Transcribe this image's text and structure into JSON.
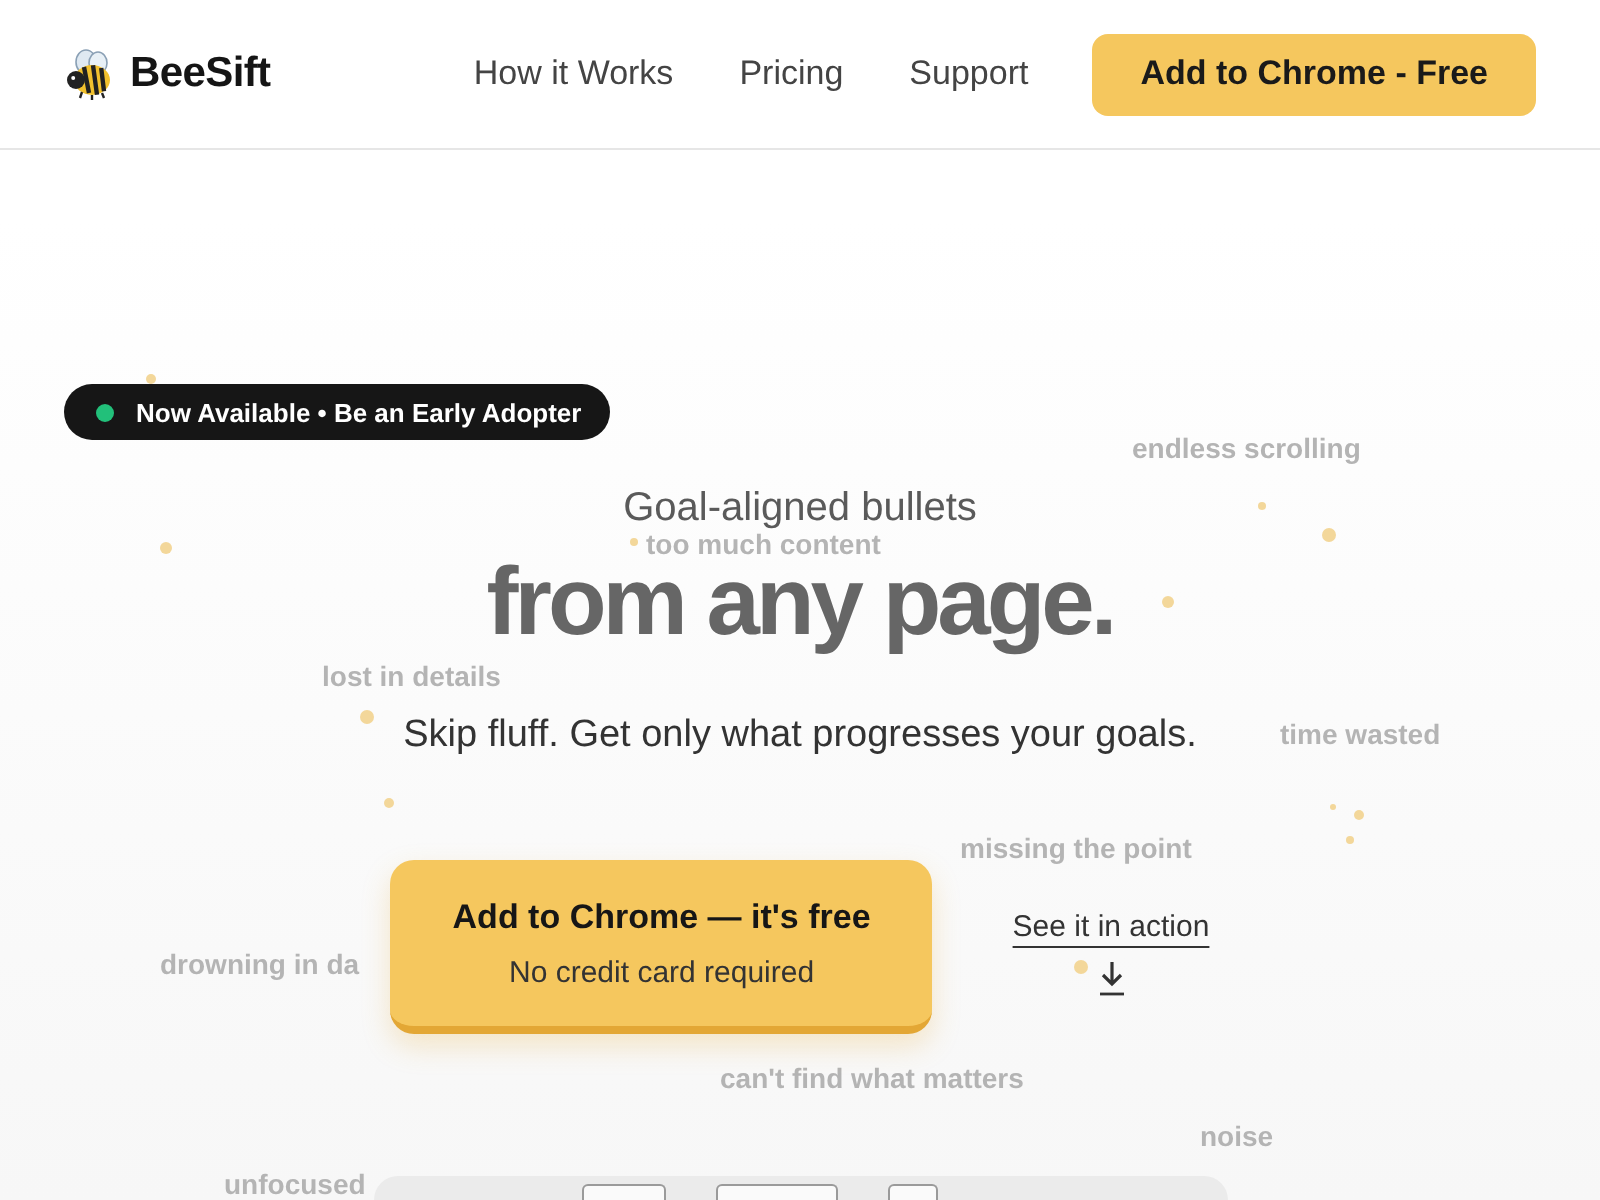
{
  "header": {
    "logo": "BeeSift",
    "nav": [
      "How it Works",
      "Pricing",
      "Support"
    ],
    "cta": "Add to Chrome - Free"
  },
  "hero": {
    "badge": "Now Available • Be an Early Adopter",
    "eyebrow": "Goal-aligned bullets",
    "headline": "from any page.",
    "subtitle": "Skip fluff. Get only what progresses your goals.",
    "primary_button": {
      "label": "Add to Chrome — it's free",
      "note": "No credit card required"
    },
    "secondary_link": "See it in action"
  },
  "background_words": [
    "endless scrolling",
    "too much content",
    "lost in details",
    "time wasted",
    "missing the point",
    "drowning in da",
    "can't find what matters",
    "noise",
    "unfocused"
  ]
}
